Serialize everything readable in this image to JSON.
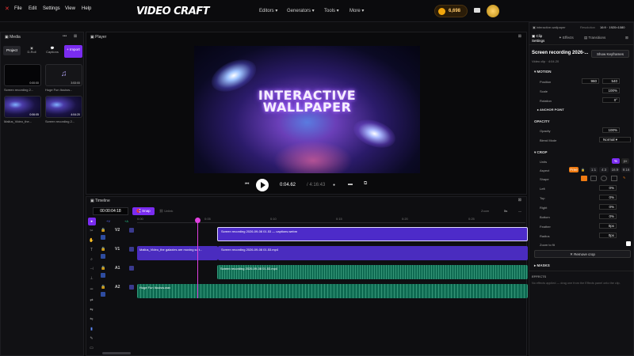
{
  "menu": [
    "File",
    "Edit",
    "Settings",
    "View",
    "Help"
  ],
  "logo": "VIDEO CRAFT",
  "nav": [
    "Editors",
    "Generators",
    "Tools",
    "More"
  ],
  "credits": "6,698",
  "media": {
    "title": "Media",
    "tabs": [
      "Project",
      "D-Roll",
      "Captions"
    ],
    "import": "+ Import",
    "items": [
      {
        "name": "Screen recording 2...",
        "dur": "0:00:00"
      },
      {
        "name": "Huge Fun Itouisw...",
        "dur": "3:53:00"
      },
      {
        "name": "Mallus_Video_the...",
        "dur": "0:06:05"
      },
      {
        "name": "Screen recording 2...",
        "dur": "4:04:20"
      }
    ]
  },
  "player": {
    "title": "Player",
    "line1": "INTERACTIVE",
    "line2": "WALLPAPER",
    "time": "0:04.62",
    "total": "/ 4:16:43"
  },
  "timeline": {
    "title": "Timeline",
    "timecode": "00:00:04:18",
    "snap": "Snap",
    "unlink": "Unlink",
    "zoom": "Zoom",
    "zoom_val": "5s",
    "add_v": "+V",
    "add_a": "+A",
    "ticks": [
      "0:00",
      "0:05",
      "0:10",
      "0:15",
      "0:20",
      "0:25"
    ],
    "tracks": [
      "V2",
      "V1",
      "A1",
      "A2"
    ],
    "clips": {
      "v2": "Screen recording 2026-09-08 01.53 — captions.webm",
      "v1a": "Mallus_Video_the galaxies are moving so t...",
      "v1b": "Screen recording 2026-09-08 01.53.mp4",
      "a1": "Screen recording 2026-09-08 01.53.mp4",
      "a2": "Huge Fun Itouisw.wav"
    }
  },
  "right": {
    "project": "interactive-wallpaper",
    "resolution_label": "Resolution",
    "resolution": "16:9 · 1920×1080",
    "tabs": [
      "Clip Settings",
      "Effects",
      "Transitions"
    ],
    "clip_title": "Screen recording 2026-...",
    "show_keyframes": "Show Keyframes",
    "clip_meta": "Video clip · 4:04.20",
    "motion": "MOTION",
    "position": "Position",
    "pos_x": "960",
    "pos_y": "540",
    "scale": "Scale",
    "scale_val": "100%",
    "rotation": "Rotation",
    "rotation_val": "0°",
    "anchor": "ANCHOR POINT",
    "opacity_h": "OPACITY",
    "opacity": "Opacity",
    "opacity_val": "100%",
    "blend": "Blend Mode",
    "blend_val": "Normal",
    "crop": "CROP",
    "units": "Units",
    "units_opts": [
      "%",
      "px"
    ],
    "aspect": "Aspect",
    "aspect_opts": [
      "Free",
      "1:1",
      "4:3",
      "16:9",
      "9:16"
    ],
    "shape": "Shape",
    "left": "Left",
    "top": "Top",
    "right_l": "Right",
    "bottom": "Bottom",
    "feather": "Feather",
    "radius": "Radius",
    "crop_vals": [
      "0%",
      "0%",
      "0%",
      "0%",
      "0px",
      "0px"
    ],
    "zoom_fit": "Zoom to fit",
    "remove_crop": "✕ Remove crop",
    "masks": "MASKS",
    "effects_h": "EFFECTS",
    "effects_note": "No effects applied — drag one from the Effects panel onto the clip."
  },
  "colors": {
    "accent": "#7a2cf0",
    "teal": "#137a5e",
    "coin": "#f2a60c"
  }
}
